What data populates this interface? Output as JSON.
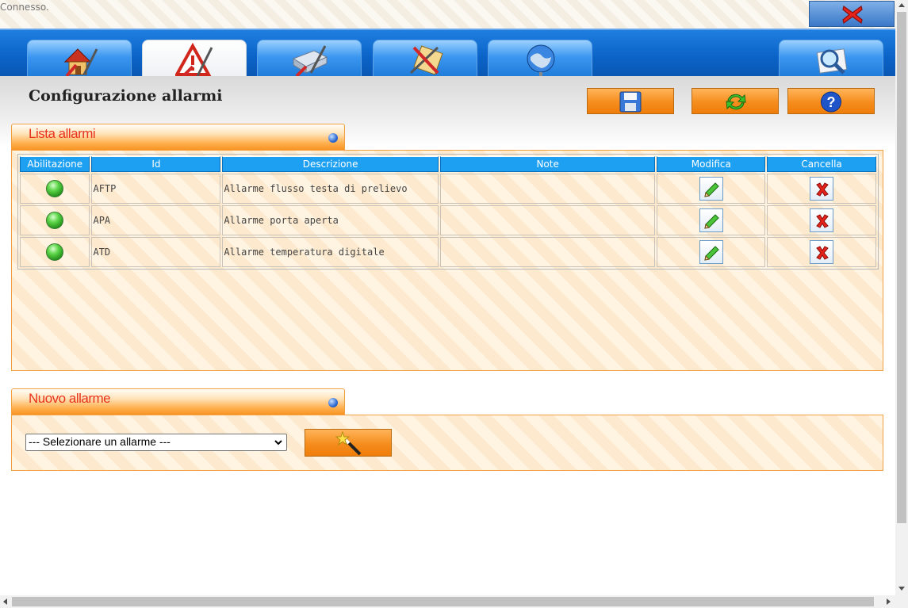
{
  "status": {
    "text": "Connesso."
  },
  "tabs": [
    {
      "name": "home-tools-icon",
      "active": false
    },
    {
      "name": "alarm-config-icon",
      "active": true
    },
    {
      "name": "device-config-icon",
      "active": false
    },
    {
      "name": "tools-config-icon",
      "active": false
    },
    {
      "name": "network-icon",
      "active": false
    },
    {
      "name": "search-icon",
      "active": false
    }
  ],
  "header": {
    "title": "Configurazione allarmi"
  },
  "toolbar": {
    "save_icon": "floppy-icon",
    "refresh_icon": "refresh-icon",
    "help_icon": "help-icon"
  },
  "alarm_list": {
    "title": "Lista allarmi",
    "columns": [
      "Abilitazione",
      "Id",
      "Descrizione",
      "Note",
      "Modifica",
      "Cancella"
    ],
    "rows": [
      {
        "enabled": true,
        "id": "AFTP",
        "description": "Allarme flusso testa di prelievo",
        "note": ""
      },
      {
        "enabled": true,
        "id": "APA",
        "description": "Allarme porta aperta",
        "note": ""
      },
      {
        "enabled": true,
        "id": "ATD",
        "description": "Allarme temperatura digitale",
        "note": ""
      }
    ]
  },
  "new_alarm": {
    "title": "Nuovo allarme",
    "select_value": "--- Selezionare un allarme ---",
    "wizard_icon": "magic-wand-icon"
  },
  "colors": {
    "accent_orange": "#f58d1d",
    "tab_blue": "#1e7ad8",
    "header_blue": "#1ea0f2",
    "title_red": "#e8341c"
  }
}
